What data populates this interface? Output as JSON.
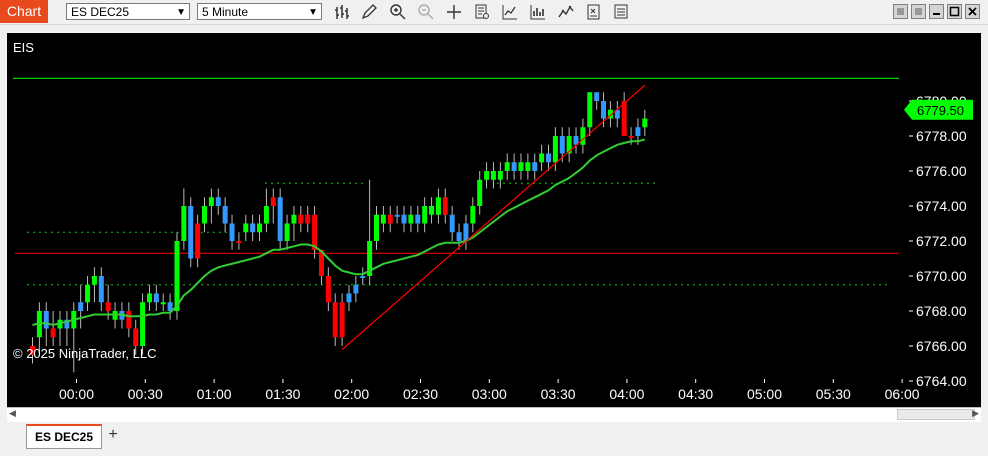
{
  "app": {
    "tab_label": "Chart"
  },
  "toolbar": {
    "instrument": "ES DEC25",
    "interval": "5 Minute",
    "icons": [
      "bar-style-icon",
      "draw-pencil-icon",
      "zoom-in-icon",
      "zoom-out-icon",
      "crosshair-icon",
      "properties-icon",
      "indicators-icon",
      "strategies-icon",
      "chart-trader-icon",
      "alerts-icon",
      "data-box-icon"
    ]
  },
  "chart": {
    "label": "EIS",
    "copyright": "© 2025 NinjaTrader, LLC",
    "last_price": "6779.50",
    "colors": {
      "up": "#00ff00",
      "down": "#ff0000",
      "up_hollow": "#3399ff",
      "sma": "#32cd32",
      "trendline": "#ff0000",
      "hline": "#ff0000",
      "dotted": "#00cc00"
    }
  },
  "chart_data": {
    "type": "candlestick",
    "title": "",
    "ylim": [
      6763,
      6781.5
    ],
    "yticks": [
      "6780.00",
      "6778.00",
      "6776.00",
      "6774.00",
      "6772.00",
      "6770.00",
      "6768.00",
      "6766.00",
      "6764.00"
    ],
    "yvals": [
      6780,
      6778,
      6776,
      6774,
      6772,
      6770,
      6768,
      6766,
      6764
    ],
    "xticks": [
      "00:00",
      "00:30",
      "01:00",
      "01:30",
      "02:00",
      "02:30",
      "03:00",
      "03:30",
      "04:00",
      "04:30",
      "05:00",
      "05:30",
      "06:00"
    ],
    "candles": [
      [
        6765.5,
        6766.5,
        6765,
        6766,
        "d"
      ],
      [
        6766.5,
        6768.5,
        6765.5,
        6768,
        "u"
      ],
      [
        6768,
        6768.5,
        6766,
        6767,
        "b"
      ],
      [
        6767,
        6768,
        6766,
        6766.5,
        "d"
      ],
      [
        6767,
        6768,
        6766,
        6767.5,
        "u"
      ],
      [
        6767.5,
        6768,
        6766,
        6767,
        "b"
      ],
      [
        6767,
        6768.5,
        6764.5,
        6768,
        "u"
      ],
      [
        6768,
        6769.5,
        6767,
        6768.5,
        "b"
      ],
      [
        6768.5,
        6770,
        6768,
        6769.5,
        "u"
      ],
      [
        6769.5,
        6770.5,
        6768.5,
        6770,
        "u"
      ],
      [
        6770,
        6770.5,
        6768,
        6768.5,
        "b"
      ],
      [
        6768.5,
        6769.5,
        6767.5,
        6768,
        "d"
      ],
      [
        6768,
        6768.5,
        6767,
        6767.5,
        "u"
      ],
      [
        6767.5,
        6768.5,
        6767,
        6768,
        "b"
      ],
      [
        6768,
        6768.5,
        6766.5,
        6767,
        "d"
      ],
      [
        6767,
        6767.5,
        6765.5,
        6766,
        "d"
      ],
      [
        6766,
        6769,
        6765.5,
        6768.5,
        "u"
      ],
      [
        6768.5,
        6769.5,
        6768,
        6769,
        "u"
      ],
      [
        6769,
        6769.5,
        6768,
        6768.5,
        "b"
      ],
      [
        6768.5,
        6769,
        6768,
        6768.5,
        "u"
      ],
      [
        6768.5,
        6769,
        6767.5,
        6768,
        "b"
      ],
      [
        6768,
        6772.5,
        6767.5,
        6772,
        "u"
      ],
      [
        6772,
        6775,
        6771.5,
        6774,
        "u"
      ],
      [
        6774,
        6774.5,
        6770.5,
        6771,
        "b"
      ],
      [
        6771,
        6773.5,
        6770.5,
        6773,
        "d"
      ],
      [
        6773,
        6774.5,
        6772.5,
        6774,
        "u"
      ],
      [
        6774,
        6775,
        6773,
        6774.5,
        "u"
      ],
      [
        6774.5,
        6775,
        6773.5,
        6774,
        "b"
      ],
      [
        6774,
        6774.5,
        6772.5,
        6773,
        "b"
      ],
      [
        6773,
        6773.5,
        6771.5,
        6772,
        "b"
      ],
      [
        6772,
        6772.5,
        6771.5,
        6772,
        "d"
      ],
      [
        6772.5,
        6773.5,
        6772,
        6773,
        "u"
      ],
      [
        6773,
        6773.5,
        6772,
        6772.5,
        "b"
      ],
      [
        6772.5,
        6773.5,
        6772,
        6773,
        "u"
      ],
      [
        6773,
        6775,
        6772.5,
        6774,
        "u"
      ],
      [
        6774,
        6775,
        6773,
        6774.5,
        "d"
      ],
      [
        6774.5,
        6775,
        6771.5,
        6772,
        "b"
      ],
      [
        6772,
        6773.5,
        6771.5,
        6773,
        "u"
      ],
      [
        6773,
        6774,
        6772,
        6773.5,
        "u"
      ],
      [
        6773.5,
        6774,
        6772.5,
        6773,
        "d"
      ],
      [
        6773,
        6774,
        6772.5,
        6773.5,
        "d"
      ],
      [
        6773.5,
        6774,
        6771,
        6771.5,
        "d"
      ],
      [
        6771.5,
        6771.5,
        6769.5,
        6770,
        "d"
      ],
      [
        6770,
        6770.5,
        6768,
        6768.5,
        "d"
      ],
      [
        6768.5,
        6769,
        6766,
        6766.5,
        "d"
      ],
      [
        6766.5,
        6769,
        6766,
        6768.5,
        "d"
      ],
      [
        6768.5,
        6769.5,
        6768,
        6769,
        "b"
      ],
      [
        6769,
        6770,
        6768.5,
        6769.5,
        "b"
      ],
      [
        6770,
        6770.5,
        6769.5,
        6770,
        "b"
      ],
      [
        6770,
        6775.5,
        6769.5,
        6772,
        "u"
      ],
      [
        6772,
        6774,
        6771.5,
        6773.5,
        "u"
      ],
      [
        6773.5,
        6774,
        6772.5,
        6773,
        "u"
      ],
      [
        6773,
        6774,
        6772.5,
        6773.5,
        "d"
      ],
      [
        6773.5,
        6774,
        6773,
        6773.5,
        "b"
      ],
      [
        6773.5,
        6774,
        6772.5,
        6773,
        "b"
      ],
      [
        6773,
        6774,
        6772.5,
        6773.5,
        "u"
      ],
      [
        6773.5,
        6774,
        6772.5,
        6773,
        "b"
      ],
      [
        6773,
        6774.5,
        6772.5,
        6774,
        "u"
      ],
      [
        6774,
        6774.5,
        6773,
        6773.5,
        "u"
      ],
      [
        6773.5,
        6775,
        6773,
        6774.5,
        "u"
      ],
      [
        6774.5,
        6775,
        6773,
        6773.5,
        "d"
      ],
      [
        6773.5,
        6774,
        6772,
        6772.5,
        "b"
      ],
      [
        6772.5,
        6773,
        6771.5,
        6772,
        "b"
      ],
      [
        6772,
        6773.5,
        6771.5,
        6773,
        "b"
      ],
      [
        6773,
        6774.5,
        6772.5,
        6774,
        "u"
      ],
      [
        6774,
        6776,
        6773.5,
        6775.5,
        "u"
      ],
      [
        6775.5,
        6776.5,
        6775,
        6776,
        "u"
      ],
      [
        6776,
        6776.5,
        6775,
        6775.5,
        "u"
      ],
      [
        6775.5,
        6776.5,
        6775,
        6776,
        "u"
      ],
      [
        6776,
        6777,
        6775.5,
        6776.5,
        "u"
      ],
      [
        6776.5,
        6777,
        6775.5,
        6776,
        "b"
      ],
      [
        6776,
        6777,
        6775.5,
        6776.5,
        "u"
      ],
      [
        6776.5,
        6777,
        6775.5,
        6776,
        "u"
      ],
      [
        6776,
        6777,
        6775.5,
        6776.5,
        "b"
      ],
      [
        6776.5,
        6777.5,
        6776,
        6777,
        "u"
      ],
      [
        6777,
        6777.5,
        6776,
        6776.5,
        "b"
      ],
      [
        6776.5,
        6778.5,
        6776,
        6778,
        "u"
      ],
      [
        6778,
        6778.5,
        6776.5,
        6777,
        "b"
      ],
      [
        6777,
        6778.5,
        6776.5,
        6778,
        "u"
      ],
      [
        6778,
        6778.5,
        6777,
        6777.5,
        "b"
      ],
      [
        6777.5,
        6779,
        6777,
        6778.5,
        "u"
      ],
      [
        6778.5,
        6780.5,
        6778,
        6780.5,
        "u"
      ],
      [
        6780.5,
        6780.5,
        6779.5,
        6780,
        "b"
      ],
      [
        6780,
        6780.5,
        6778.5,
        6779,
        "b"
      ],
      [
        6779,
        6780,
        6778.5,
        6779.5,
        "u"
      ],
      [
        6779.5,
        6780,
        6778.5,
        6779,
        "b"
      ],
      [
        6780,
        6780.5,
        6778,
        6778,
        "d"
      ],
      [
        6778,
        6778.5,
        6777.5,
        6778,
        "d"
      ],
      [
        6778,
        6779,
        6777.5,
        6778.5,
        "b"
      ],
      [
        6778.5,
        6779.5,
        6778,
        6779,
        "u"
      ]
    ],
    "sma": [
      6767.2,
      6767.3,
      6767.3,
      6767.2,
      6767.3,
      6767.4,
      6767.5,
      6767.6,
      6767.7,
      6767.8,
      6767.8,
      6767.8,
      6767.8,
      6767.8,
      6767.7,
      6767.7,
      6767.7,
      6767.8,
      6767.8,
      6767.9,
      6767.9,
      6768.3,
      6768.9,
      6769.2,
      6769.6,
      6770,
      6770.3,
      6770.5,
      6770.6,
      6770.7,
      6770.8,
      6770.9,
      6771,
      6771.1,
      6771.3,
      6771.5,
      6771.5,
      6771.6,
      6771.7,
      6771.8,
      6771.8,
      6771.7,
      6771.4,
      6771,
      6770.6,
      6770.3,
      6770.2,
      6770.1,
      6770.1,
      6770.3,
      6770.5,
      6770.7,
      6770.8,
      6770.9,
      6771,
      6771.1,
      6771.2,
      6771.4,
      6771.6,
      6771.8,
      6771.9,
      6771.9,
      6771.9,
      6772,
      6772.2,
      6772.5,
      6772.8,
      6773.1,
      6773.4,
      6773.7,
      6773.9,
      6774.1,
      6774.3,
      6774.5,
      6774.7,
      6774.9,
      6775.2,
      6775.4,
      6775.6,
      6775.9,
      6776.2,
      6776.6,
      6776.9,
      6777.1,
      6777.3,
      6777.5,
      6777.6,
      6777.7,
      6777.7,
      6777.8
    ],
    "levels": {
      "top_line": 6781.3,
      "resistance": 6771.3,
      "dotted": [
        6772.5,
        6775.3,
        6769.5
      ]
    },
    "trendline": {
      "from": [
        45,
        6765.8
      ],
      "to": [
        89,
        6780.9
      ]
    }
  }
}
